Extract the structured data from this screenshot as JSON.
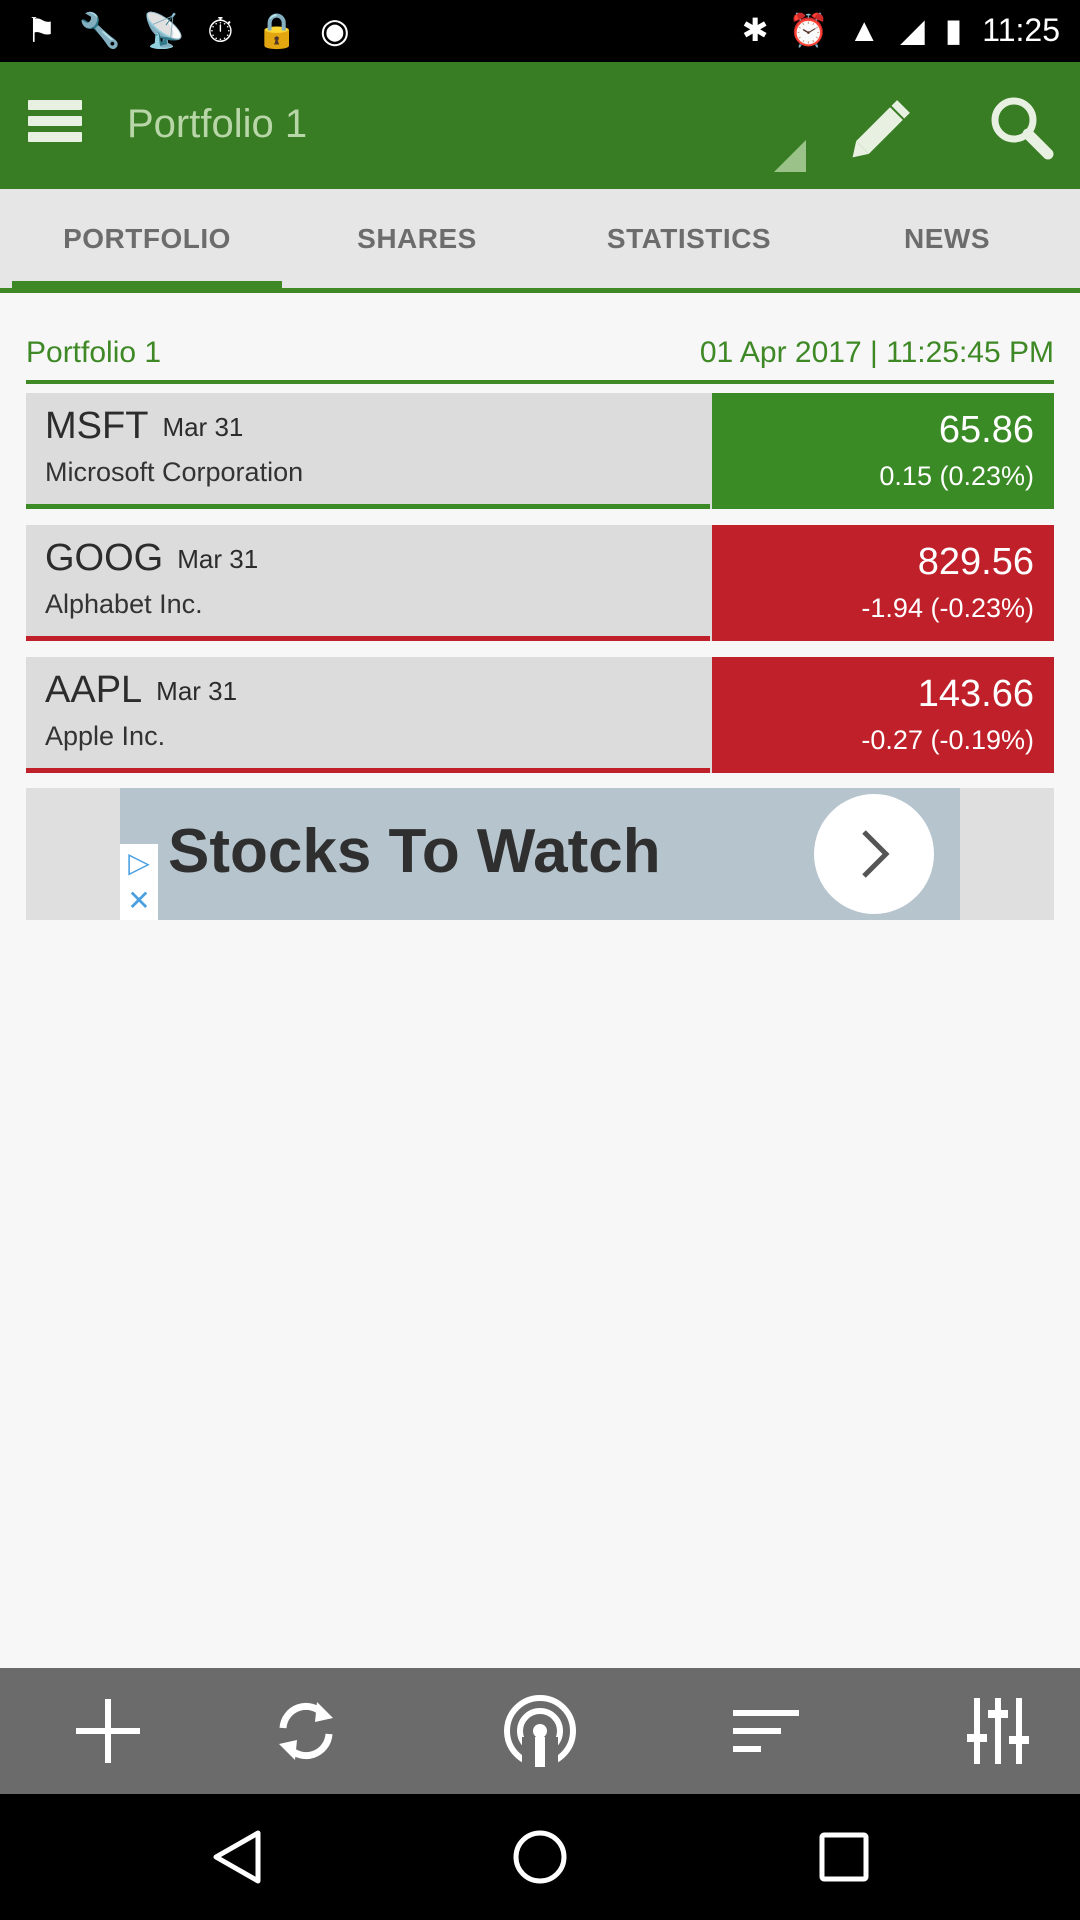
{
  "status_bar": {
    "time": "11:25",
    "left_icons": [
      "fake-gps-icon",
      "wrench-icon",
      "satellite-icon",
      "sync-icon",
      "lock-icon",
      "android-icon"
    ],
    "right_icons": [
      "bluetooth-icon",
      "alarm-icon",
      "wifi-icon",
      "signal-icon",
      "battery-icon"
    ]
  },
  "appbar": {
    "title": "Portfolio 1"
  },
  "tabs": [
    {
      "label": "PORTFOLIO",
      "active": true
    },
    {
      "label": "SHARES",
      "active": false
    },
    {
      "label": "STATISTICS",
      "active": false
    },
    {
      "label": "NEWS",
      "active": false
    }
  ],
  "portfolio": {
    "name": "Portfolio 1",
    "timestamp": "01 Apr 2017 | 11:25:45 PM"
  },
  "stocks": [
    {
      "symbol": "MSFT",
      "date": "Mar 31",
      "company": "Microsoft Corporation",
      "price": "65.86",
      "change": "0.15 (0.23%)",
      "trend": "up"
    },
    {
      "symbol": "GOOG",
      "date": "Mar 31",
      "company": "Alphabet Inc.",
      "price": "829.56",
      "change": "-1.94 (-0.23%)",
      "trend": "down"
    },
    {
      "symbol": "AAPL",
      "date": "Mar 31",
      "company": "Apple Inc.",
      "price": "143.66",
      "change": "-0.27 (-0.19%)",
      "trend": "down"
    }
  ],
  "ad": {
    "text": "Stocks To Watch"
  },
  "toolbar": [
    "add-icon",
    "refresh-icon",
    "broadcast-icon",
    "sort-icon",
    "settings-sliders-icon"
  ],
  "colors": {
    "primary": "#387d23",
    "up": "#3a8a25",
    "down": "#c0202a"
  }
}
